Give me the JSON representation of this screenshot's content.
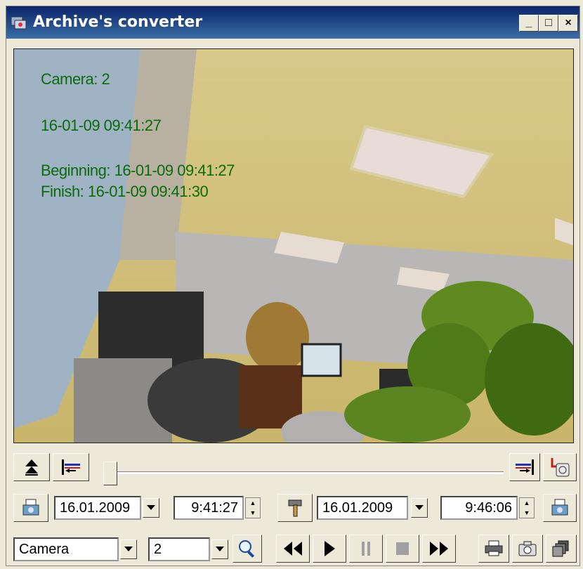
{
  "window": {
    "title": "Archive's converter",
    "minimize_label": "_",
    "maximize_label": "□",
    "close_label": "×"
  },
  "overlay": {
    "camera": "Camera: 2",
    "timestamp": "16-01-09 09:41:27",
    "beginning": "Beginning: 16-01-09 09:41:27",
    "finish": "Finish: 16-01-09 09:41:30"
  },
  "range": {
    "start_date": "16.01.2009",
    "start_time": "9:41:27",
    "end_date": "16.01.2009",
    "end_time": "9:46:06"
  },
  "source": {
    "type_value": "Camera",
    "number_value": "2"
  },
  "colors": {
    "titlebar": "#0a246a",
    "overlay_text": "#0b6b0b"
  },
  "icons": [
    "eject-icon",
    "go-to-start-icon",
    "go-to-end-icon",
    "export-disk-icon",
    "calendar-icon",
    "settings-hammer-icon",
    "search-icon",
    "rewind-icon",
    "play-icon",
    "pause-icon",
    "stop-icon",
    "fast-forward-icon",
    "print-icon",
    "snapshot-icon",
    "copy-windows-icon"
  ]
}
